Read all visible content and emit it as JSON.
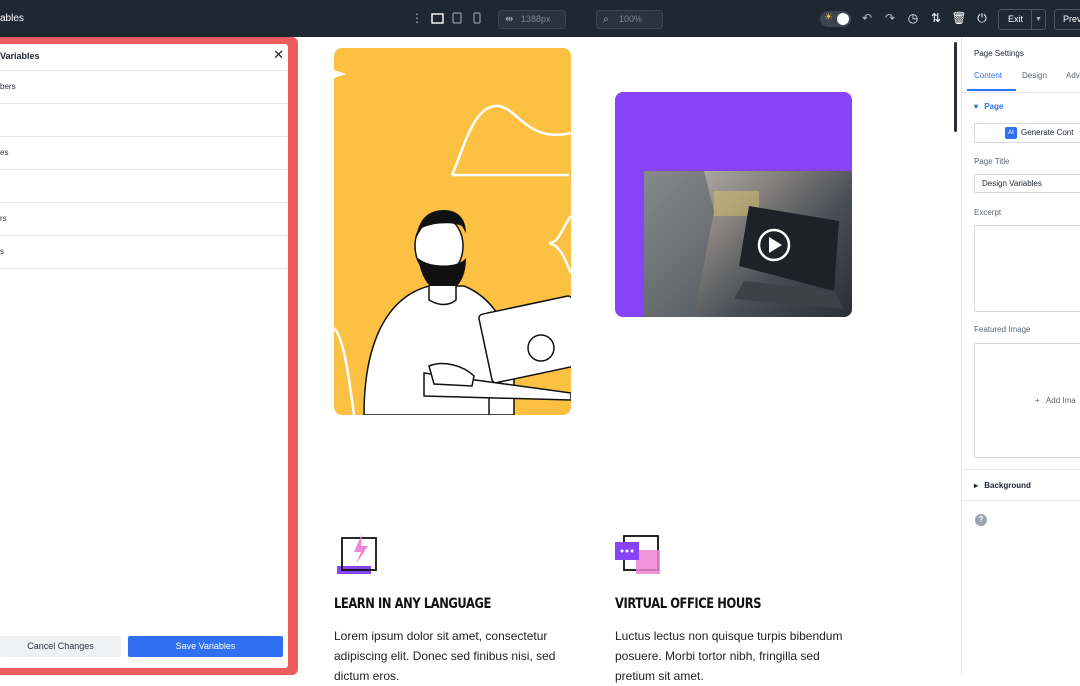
{
  "topbar": {
    "title": "ables",
    "width_field": "1388px",
    "zoom_field": "100%",
    "exit_label": "Exit",
    "preview_label": "Prev"
  },
  "left_panel": {
    "title": "Variables",
    "rows": [
      "bers",
      "",
      "es",
      "",
      "rs",
      "s"
    ],
    "cancel_label": "Cancel Changes",
    "save_label": "Save Variables"
  },
  "canvas": {
    "features": [
      {
        "title": "LEARN IN ANY LANGUAGE",
        "body": "Lorem ipsum dolor sit amet, consectetur adipiscing elit. Donec sed finibus nisi, sed dictum eros."
      },
      {
        "title": "VIRTUAL OFFICE HOURS",
        "body": "Luctus lectus non quisque turpis bibendum posuere. Morbi tortor nibh, fringilla sed pretium sit amet."
      }
    ]
  },
  "right_panel": {
    "title": "Page Settings",
    "tabs": [
      "Content",
      "Design",
      "Adv"
    ],
    "section_page": "Page",
    "generate_label": "Generate Cont",
    "ai_badge": "AI",
    "page_title_label": "Page Title",
    "page_title_value": "Design Variables",
    "excerpt_label": "Excerpt",
    "featured_image_label": "Featured Image",
    "add_image_label": "Add Ima",
    "section_background": "Background"
  },
  "colors": {
    "accent": "#2f6ff2",
    "highlight_frame": "#ef5a5c",
    "card_yellow": "#fcc043",
    "card_purple": "#8744f6"
  }
}
